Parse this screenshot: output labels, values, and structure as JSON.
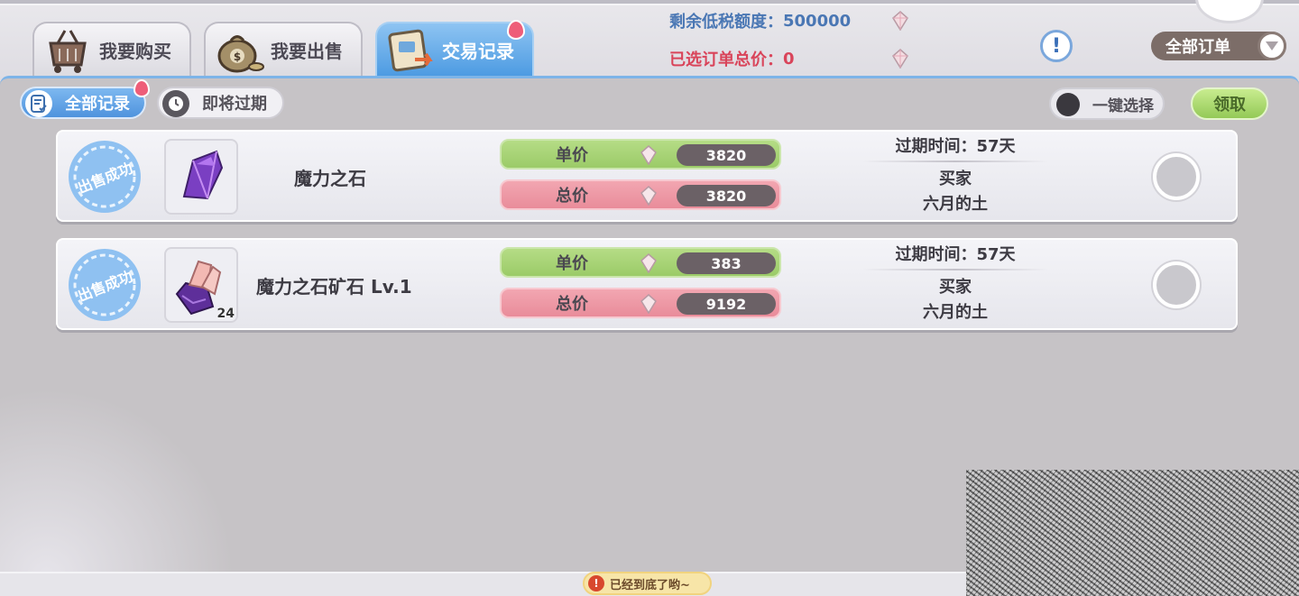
{
  "tabs": [
    {
      "label": "我要购买",
      "icon": "basket-icon"
    },
    {
      "label": "我要出售",
      "icon": "money-bag-icon"
    },
    {
      "label": "交易记录",
      "icon": "trade-record-icon"
    }
  ],
  "header": {
    "tax_quota_label": "剩余低税额度：",
    "tax_quota_value": "500000",
    "selected_total_label": "已选订单总价：",
    "selected_total_value": "0",
    "info_icon": "!",
    "order_filter": "全部订单"
  },
  "subtabs": [
    {
      "label": "全部记录",
      "icon": "record-list-icon"
    },
    {
      "label": "即将过期",
      "icon": "clock-history-icon"
    }
  ],
  "toolbar": {
    "select_all_label": "一键选择",
    "claim_label": "领取"
  },
  "records": [
    {
      "stamp": "出售成功",
      "item_name": "魔力之石",
      "item_icon": "purple-crystal-icon",
      "count": "",
      "unit_label": "单价",
      "unit_price": "3820",
      "total_label": "总价",
      "total_price": "3820",
      "expire_text": "过期时间：57天",
      "buyer_label": "买家",
      "buyer_name": "六月的土"
    },
    {
      "stamp": "出售成功",
      "item_name": "魔力之石矿石 Lv.1",
      "item_icon": "crystal-ore-icon",
      "count": "24",
      "unit_label": "单价",
      "unit_price": "383",
      "total_label": "总价",
      "total_price": "9192",
      "expire_text": "过期时间：57天",
      "buyer_label": "买家",
      "buyer_name": "六月的土"
    }
  ],
  "footer": {
    "warn_icon": "!",
    "end_message": "已经到底了哟~"
  },
  "colors": {
    "active_tab": "#4d9be2",
    "unit_price_bar": "#9bcb68",
    "total_price_bar": "#e98c9a",
    "tax_text": "#4a77b4",
    "total_text": "#d9445a"
  }
}
